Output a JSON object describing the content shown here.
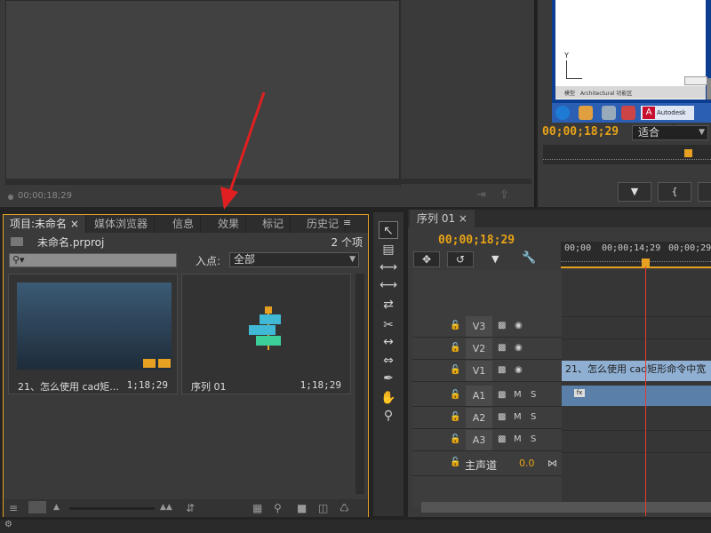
{
  "source_monitor": {
    "timecode": "00;00;18;29"
  },
  "program_monitor": {
    "timecode": "00;00;18;29",
    "fit_label": "适合",
    "screen_y_label": "Y",
    "screen_tab1": "模型",
    "screen_tab2": "Architectural 功能区",
    "taskbar_item": "Autodesk AutoC..."
  },
  "project_panel": {
    "tabs": [
      "项目:未命名",
      "媒体浏览器",
      "信息",
      "效果",
      "标记",
      "历史记"
    ],
    "filename": "未命名.prproj",
    "item_count": "2 个项",
    "inpoint_label": "入点:",
    "inpoint_value": "全部",
    "items": [
      {
        "name": "21、怎么使用 cad矩...",
        "duration": "1;18;29"
      },
      {
        "name": "序列 01",
        "duration": "1;18;29"
      }
    ]
  },
  "timeline": {
    "tab": "序列 01",
    "timecode": "00;00;18;29",
    "ruler_labels": [
      "00;00",
      "00;00;14;29",
      "00;00;29;"
    ],
    "tracks": [
      {
        "name": "V3",
        "type": "video"
      },
      {
        "name": "V2",
        "type": "video"
      },
      {
        "name": "V1",
        "type": "video"
      },
      {
        "name": "A1",
        "type": "audio"
      },
      {
        "name": "A2",
        "type": "audio"
      },
      {
        "name": "A3",
        "type": "audio"
      }
    ],
    "v1_clip_label": "21、怎么使用 cad矩形命令中宽",
    "a1_clip_badge": "fx",
    "master_label": "主声道",
    "master_value": "0.0"
  },
  "icons": {
    "search": "search-icon",
    "lock": "lock-icon",
    "eye": "eye-icon"
  },
  "colors": {
    "accent_timecode": "#e8a317",
    "playhead": "#e53c2e",
    "panel_highlight": "#e6a122",
    "annotation": "#e02020"
  }
}
